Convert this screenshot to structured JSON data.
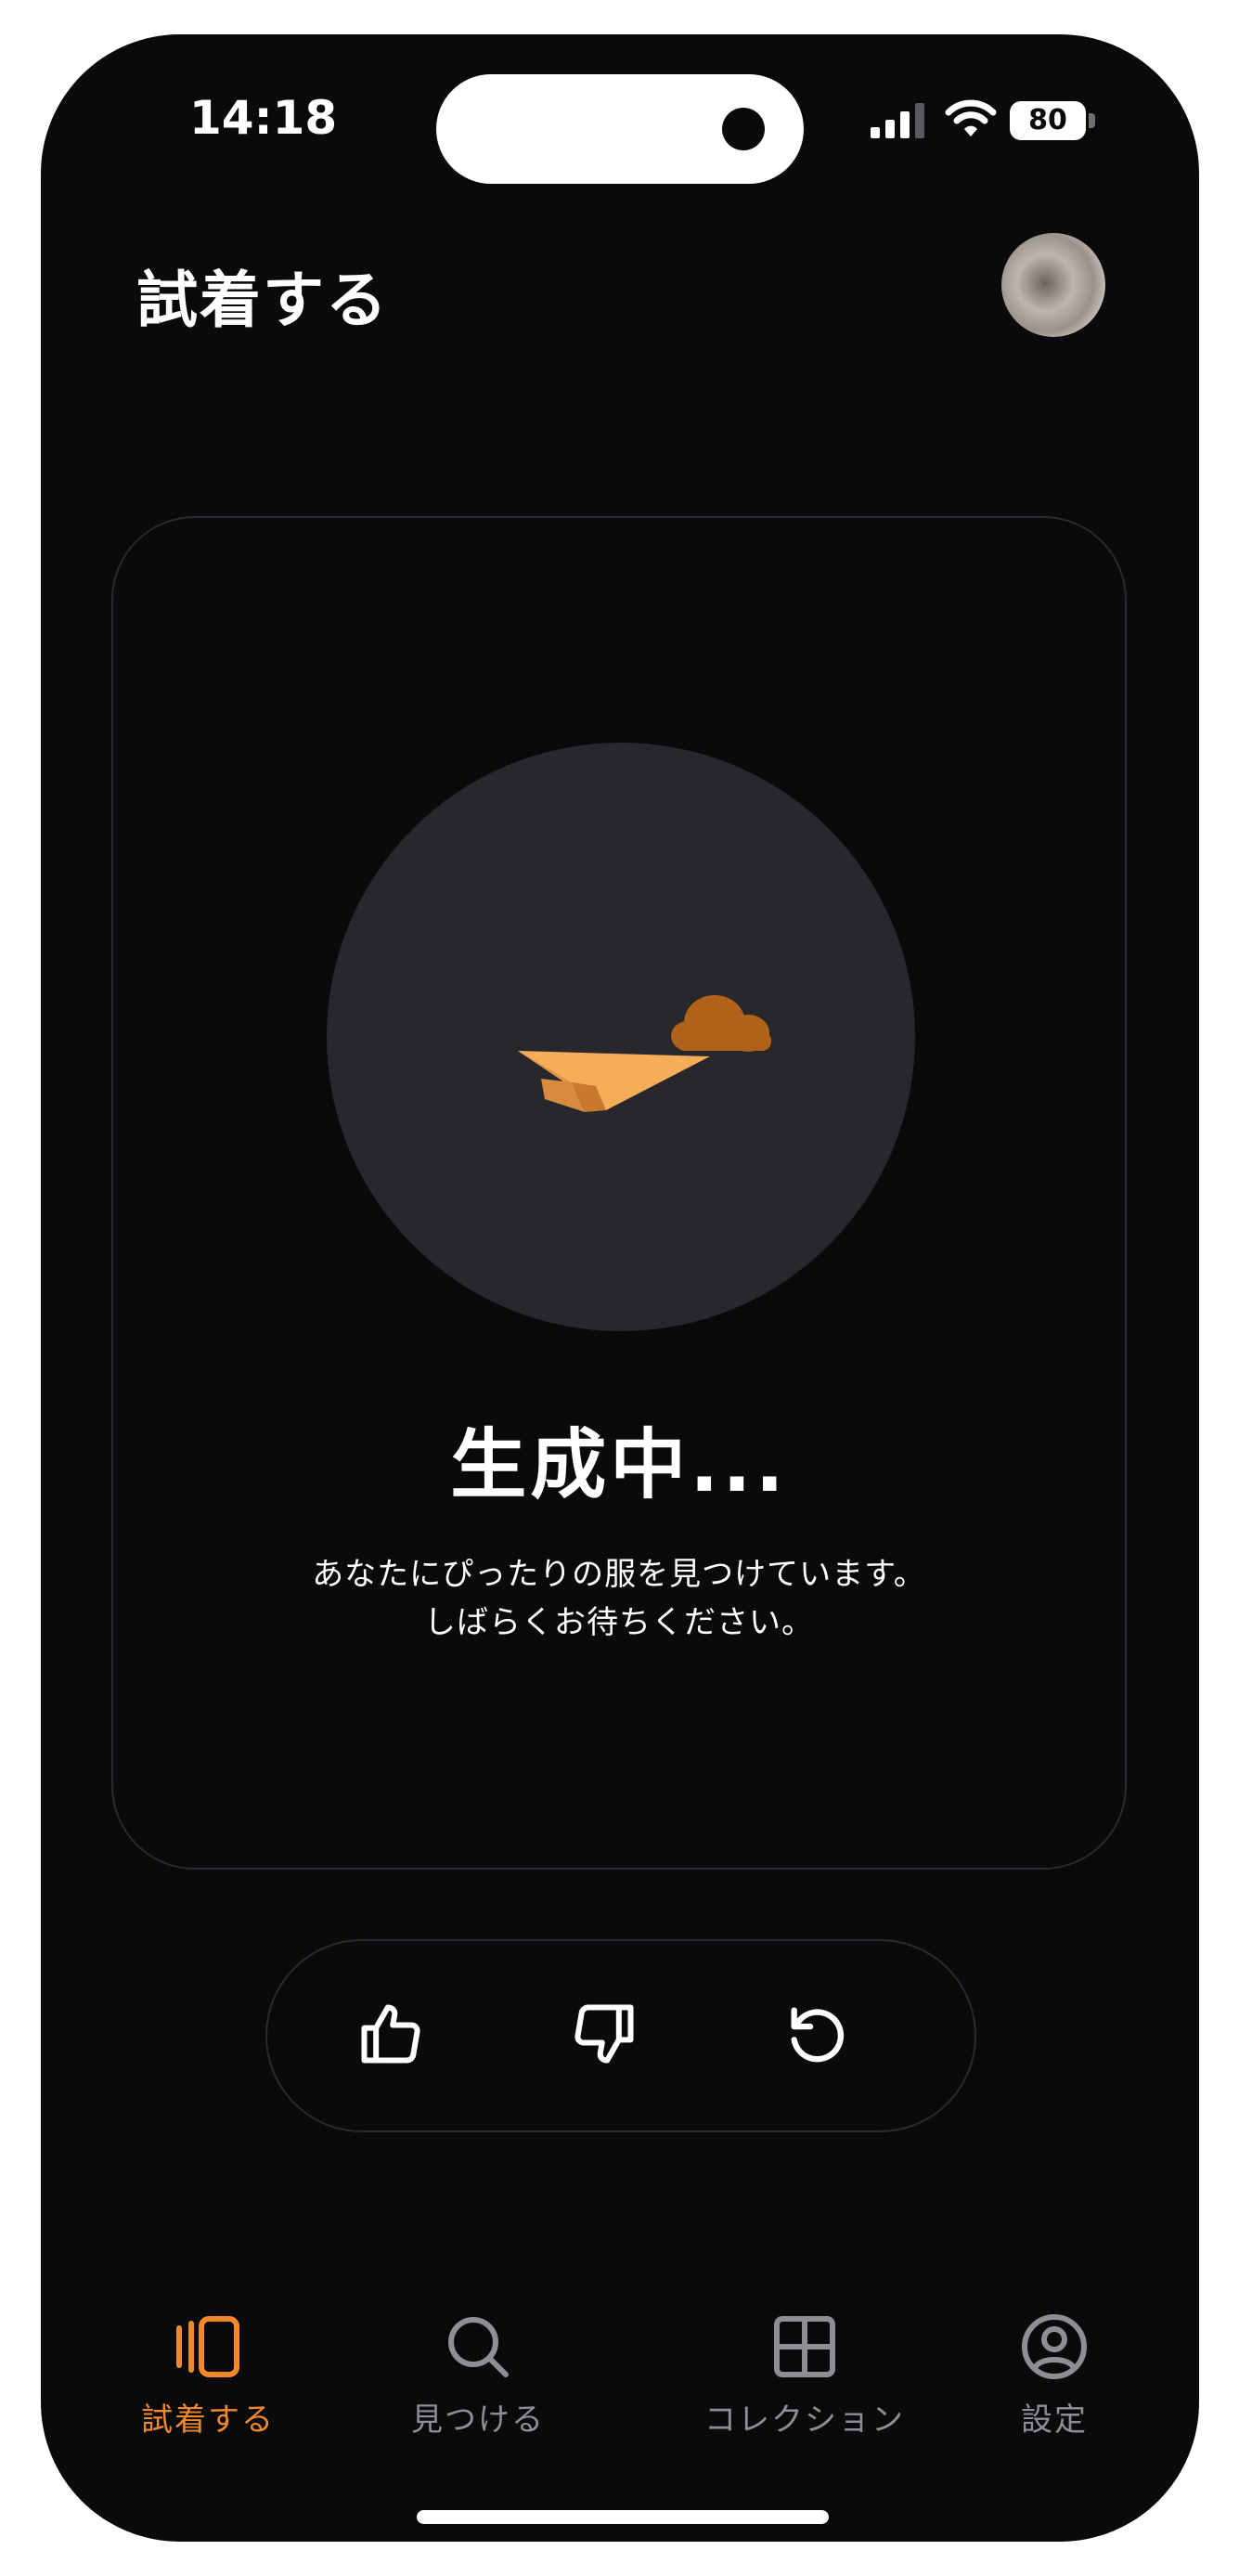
{
  "status_bar": {
    "time": "14:18",
    "battery": "80"
  },
  "header": {
    "title": "試着する"
  },
  "card": {
    "heading": "生成中...",
    "message_line1": "あなたにぴったりの服を見つけています。",
    "message_line2": "しばらくお待ちください。"
  },
  "actions": {
    "like": "thumbs-up-icon",
    "dislike": "thumbs-down-icon",
    "retry": "refresh-icon"
  },
  "tabs": [
    {
      "label": "試着する",
      "icon": "try-on-icon",
      "active": true
    },
    {
      "label": "見つける",
      "icon": "search-icon",
      "active": false
    },
    {
      "label": "コレクション",
      "icon": "grid-icon",
      "active": false
    },
    {
      "label": "設定",
      "icon": "profile-icon",
      "active": false
    }
  ],
  "colors": {
    "background": "#0a0a0c",
    "accent": "#f0882d",
    "inactive_tab": "#8e8e93",
    "loader_circle": "#28282c",
    "plane": "#f5ad5a",
    "cloud": "#b0621a"
  }
}
